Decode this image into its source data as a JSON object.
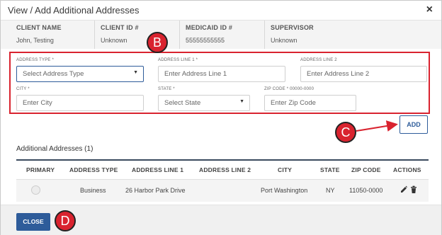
{
  "modal": {
    "title": "View / Add Additional Addresses",
    "close_glyph": "×"
  },
  "client_info": [
    {
      "label": "CLIENT NAME",
      "value": "John, Testing"
    },
    {
      "label": "CLIENT ID #",
      "value": "Unknown"
    },
    {
      "label": "MEDICAID ID #",
      "value": "55555555555"
    },
    {
      "label": "SUPERVISOR",
      "value": "Unknown"
    }
  ],
  "form": {
    "address_type": {
      "label": "ADDRESS TYPE *",
      "value": "Select Address Type"
    },
    "address_line_1": {
      "label": "ADDRESS LINE 1 *",
      "placeholder": "Enter Address Line 1"
    },
    "address_line_2": {
      "label": "ADDRESS LINE 2",
      "placeholder": "Enter Address Line 2"
    },
    "city": {
      "label": "CITY *",
      "placeholder": "Enter City"
    },
    "state": {
      "label": "STATE *",
      "value": "Select State"
    },
    "zip": {
      "label": "ZIP CODE * 00000-0000",
      "placeholder": "Enter Zip Code"
    },
    "add_label": "ADD"
  },
  "markers": {
    "b": "B",
    "c": "C",
    "d": "D"
  },
  "section_title": "Additional Addresses (1)",
  "table": {
    "headers": [
      "PRIMARY",
      "ADDRESS TYPE",
      "ADDRESS LINE 1",
      "ADDRESS LINE 2",
      "CITY",
      "STATE",
      "ZIP CODE",
      "ACTIONS"
    ],
    "rows": [
      {
        "address_type": "Business",
        "address_line_1": "26 Harbor Park Drive",
        "address_line_2": "",
        "city": "Port Washington",
        "state": "NY",
        "zip": "11050-0000"
      }
    ]
  },
  "footer": {
    "close_label": "CLOSE"
  },
  "icons": {
    "edit": "pencil-icon",
    "delete": "trash-icon",
    "dropdown": "caret-down-icon"
  },
  "colors": {
    "accent": "#2e5c9a",
    "marker": "#d9232f",
    "header_rule": "#3a4a5e"
  }
}
